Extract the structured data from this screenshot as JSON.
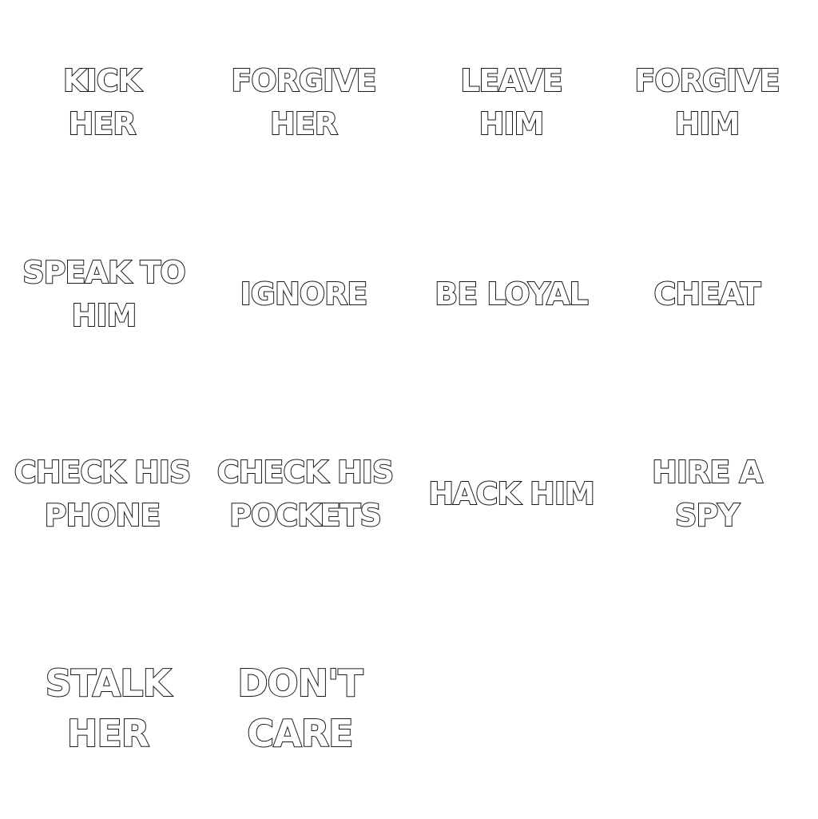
{
  "choices": [
    {
      "line1": "KICK",
      "line2": "HER"
    },
    {
      "line1": "FORGIVE",
      "line2": "HER"
    },
    {
      "line1": "LEAVE",
      "line2": "HIM"
    },
    {
      "line1": "FORGIVE",
      "line2": "HIM"
    },
    {
      "line1": "SPEAK TO",
      "line2": "HIM"
    },
    {
      "line1": "IGNORE",
      "line2": ""
    },
    {
      "line1": "BE LOYAL",
      "line2": ""
    },
    {
      "line1": "CHEAT",
      "line2": ""
    },
    {
      "line1": "CHECK HIS",
      "line2": "PHONE"
    },
    {
      "line1": "CHECK HIS",
      "line2": "POCKETS"
    },
    {
      "line1": "HACK HIM",
      "line2": ""
    },
    {
      "line1": "HIRE A",
      "line2": "SPY"
    },
    {
      "line1": "STALK",
      "line2": "HER"
    },
    {
      "line1": "DON'T",
      "line2": "CARE"
    }
  ],
  "colors": {
    "background": "#ffffff",
    "text_fill": "#ffffff",
    "text_outline": "#1a1a1a"
  }
}
